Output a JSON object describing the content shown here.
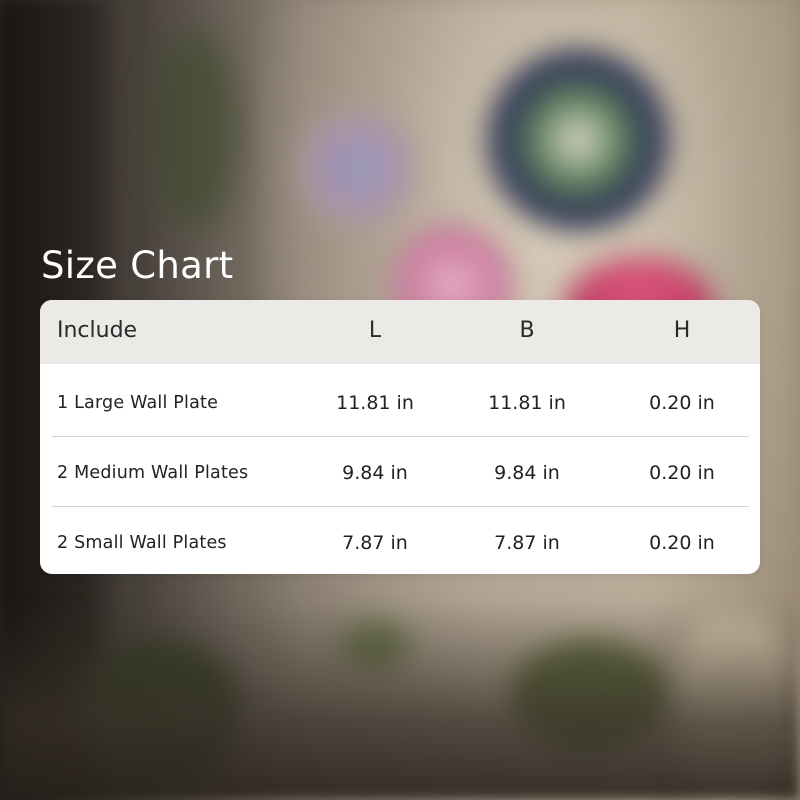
{
  "title": "Size Chart",
  "table": {
    "headers": [
      "Include",
      "L",
      "B",
      "H"
    ],
    "rows": [
      {
        "name": "1 Large Wall Plate",
        "l": "11.81 in",
        "b": "11.81 in",
        "h": "0.20 in"
      },
      {
        "name": "2 Medium Wall Plates",
        "l": "9.84 in",
        "b": "9.84 in",
        "h": "0.20 in"
      },
      {
        "name": "2 Small Wall Plates",
        "l": "7.87 in",
        "b": "7.87 in",
        "h": "0.20 in"
      }
    ]
  },
  "colors": {
    "title_text": "#ffffff",
    "card_background": "#ffffff",
    "header_background": "#eceae6",
    "text": "#222222",
    "divider": "#d6d4d0"
  },
  "background": {
    "description_icons": [
      "window-icon",
      "plant-icon",
      "wall-plate-icon"
    ]
  }
}
